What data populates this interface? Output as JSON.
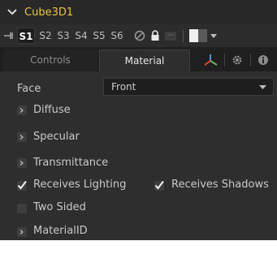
{
  "node": {
    "title": "Cube3D1"
  },
  "slots": [
    "S1",
    "S2",
    "S3",
    "S4",
    "S5",
    "S6"
  ],
  "tabs": {
    "controls": "Controls",
    "material": "Material"
  },
  "face": {
    "label": "Face",
    "value": "Front"
  },
  "groups": [
    "Diffuse",
    "Specular",
    "Transmittance"
  ],
  "options": {
    "receives_lighting": {
      "label": "Receives Lighting",
      "checked": true
    },
    "receives_shadows": {
      "label": "Receives Shadows",
      "checked": true
    },
    "two_sided": {
      "label": "Two Sided",
      "checked": false
    }
  },
  "material_id": {
    "label": "MaterialID"
  },
  "colors": {
    "title": "#e8c34a",
    "background": "#2e2e2e",
    "tab_bar": "#1f1f1f",
    "accent_axis_x": "#d04a3a",
    "accent_axis_y": "#6bb05a",
    "accent_axis_z": "#5a8ad0"
  }
}
